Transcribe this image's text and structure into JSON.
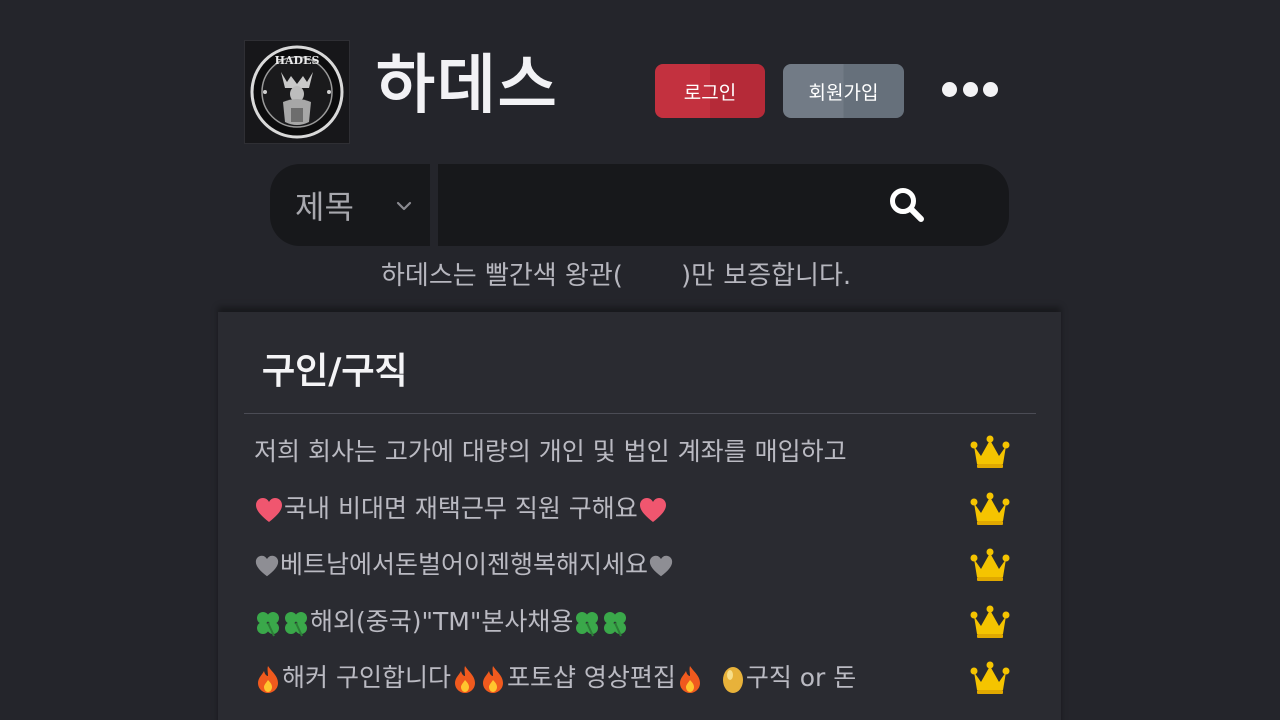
{
  "header": {
    "site_title": "하데스",
    "logo_text": "HADES",
    "login_label": "로그인",
    "signup_label": "회원가입",
    "more_icon": "more-dots-icon"
  },
  "search": {
    "field_label": "제목",
    "query": "",
    "placeholder": "",
    "submit_icon": "search-icon"
  },
  "notice": {
    "before": "하데스는 빨간색 왕관(",
    "after": ")만 보증합니다."
  },
  "board": {
    "title": "구인/구직",
    "posts": [
      {
        "title": "저희 회사는 고가에 대량의 개인 및 법인 계좌를 매입하고",
        "badge": "crown-icon"
      },
      {
        "prefix_icon": "pink-heart-icon",
        "title": "국내 비대면 재택근무 직원 구해요",
        "suffix_icon": "pink-heart-icon",
        "badge": "crown-icon"
      },
      {
        "prefix_icon": "grey-heart-icon",
        "title": "베트남에서돈벌어이젠행복해지세요",
        "suffix_icon": "grey-heart-icon",
        "badge": "crown-icon"
      },
      {
        "prefix_icon": "clover-icon",
        "title": "해외(중국)\"TM\"본사채용",
        "suffix_icon": "clover-icon",
        "badge": "crown-icon"
      },
      {
        "title_parts": [
          "해커 구인합니다",
          "포토샵 영상편집",
          "구직 or 돈"
        ],
        "badge": "crown-icon"
      }
    ]
  },
  "colors": {
    "background": "#24252b",
    "panel": "#2a2b31",
    "login_button": "#c3313f",
    "signup_button": "#727b86",
    "crown": "#f5c400"
  }
}
